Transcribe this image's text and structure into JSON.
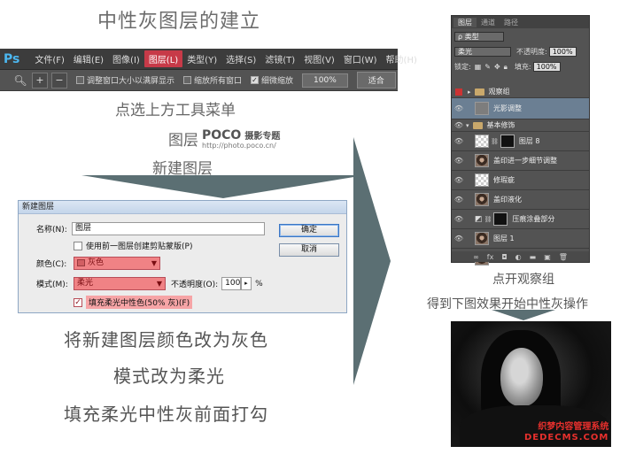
{
  "title": "中性灰图层的建立",
  "captions": {
    "click_menu": "点选上方工具菜单",
    "layer": "图层",
    "new_layer": "新建图层",
    "color_gray": "将新建图层颜色改为灰色",
    "mode_soft": "模式改为柔光",
    "fill_check": "填充柔光中性灰前面打勾",
    "open_group": "点开观察组",
    "result": "得到下图效果开始中性灰操作"
  },
  "poco": {
    "logo": "POCO",
    "topic": "摄影专题",
    "url": "http://photo.poco.cn/"
  },
  "menubar": {
    "app": "Ps",
    "items": [
      "文件(F)",
      "编辑(E)",
      "图像(I)",
      "图层(L)",
      "类型(Y)",
      "选择(S)",
      "滤镜(T)",
      "视图(V)",
      "窗口(W)",
      "帮助(H)"
    ],
    "active_index": 3
  },
  "optbar": {
    "resize_windows": "调整窗口大小以满屏显示",
    "zoom_all": "缩放所有窗口",
    "scrubby_zoom": "细微缩放",
    "zoom_value": "100%",
    "fit_screen": "适合"
  },
  "dialog": {
    "title": "新建图层",
    "name_label": "名称(N):",
    "name_value": "图层",
    "clip_label": "使用前一图层创建剪贴蒙版(P)",
    "color_label": "颜色(C):",
    "color_value": "灰色",
    "mode_label": "模式(M):",
    "mode_value": "柔光",
    "opacity_label": "不透明度(O):",
    "opacity_value": "100",
    "opacity_unit": "%",
    "fill_label": "填充柔光中性色(50% 灰)(F)",
    "ok": "确定",
    "cancel": "取消"
  },
  "panel": {
    "tabs": [
      "图层",
      "通道",
      "路径"
    ],
    "kind": "类型",
    "blend": "柔光",
    "opacity_label": "不透明度:",
    "opacity_value": "100%",
    "lock_label": "锁定:",
    "fill_label": "填充:",
    "fill_value": "100%",
    "layers": [
      {
        "name": "观察组",
        "type": "group"
      },
      {
        "name": "光影调整",
        "type": "gray",
        "selected": true
      },
      {
        "name": "基本修饰",
        "type": "group-open"
      },
      {
        "name": "图层 8",
        "type": "check-mask"
      },
      {
        "name": "盖印进一步细节调整",
        "type": "face"
      },
      {
        "name": "修瑕疵",
        "type": "check"
      },
      {
        "name": "盖印液化",
        "type": "face"
      },
      {
        "name": "压痕涂叠部分",
        "type": "adjust-mask"
      },
      {
        "name": "图层 1",
        "type": "face"
      },
      {
        "name": "背景",
        "type": "face-locked"
      }
    ]
  },
  "watermark": {
    "line1": "织梦内容管理系统",
    "line2": "DEDECMS.COM"
  }
}
